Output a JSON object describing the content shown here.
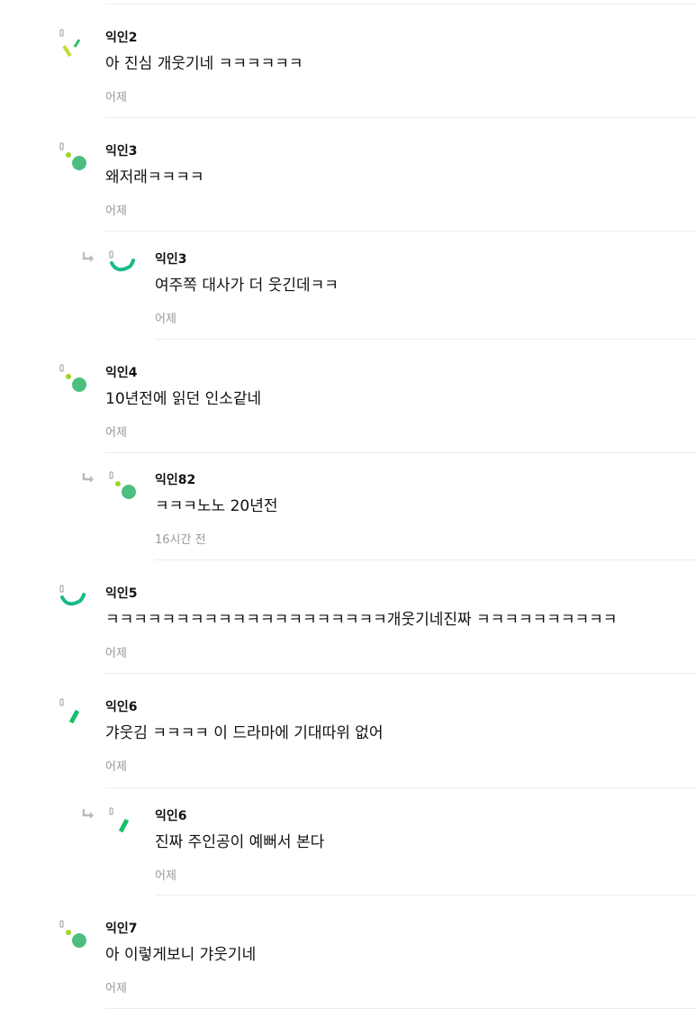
{
  "comments": [
    {
      "author": "익인2",
      "text": "아 진심 개웃기네 ㅋㅋㅋㅋㅋㅋ",
      "time": "어제",
      "avatar": "avatar-slash-icon",
      "is_reply": false
    },
    {
      "author": "익인3",
      "text": "왜저래ㅋㅋㅋㅋ",
      "time": "어제",
      "avatar": "avatar-dots-icon",
      "is_reply": false
    },
    {
      "author": "익인3",
      "text": "여주쪽 대사가 더 웃긴데ㅋㅋ",
      "time": "어제",
      "avatar": "avatar-arc-icon",
      "is_reply": true
    },
    {
      "author": "익인4",
      "text": "10년전에 읽던 인소같네",
      "time": "어제",
      "avatar": "avatar-dots-icon",
      "is_reply": false
    },
    {
      "author": "익인82",
      "text": "ㅋㅋㅋ노노 20년전",
      "time": "16시간 전",
      "avatar": "avatar-dots-icon",
      "is_reply": true
    },
    {
      "author": "익인5",
      "text": "ㅋㅋㅋㅋㅋㅋㅋㅋㅋㅋㅋㅋㅋㅋㅋㅋㅋㅋㅋㅋ개웃기네진짜 ㅋㅋㅋㅋㅋㅋㅋㅋㅋㅋ",
      "time": "어제",
      "avatar": "avatar-arc-icon",
      "is_reply": false
    },
    {
      "author": "익인6",
      "text": "갸웃김 ㅋㅋㅋㅋ 이 드라마에 기대따위 없어",
      "time": "어제",
      "avatar": "avatar-dash-icon",
      "is_reply": false
    },
    {
      "author": "익인6",
      "text": "진짜 주인공이 예뻐서 본다",
      "time": "어제",
      "avatar": "avatar-dash-icon",
      "is_reply": true
    },
    {
      "author": "익인7",
      "text": "아 이렇게보니 갸웃기네",
      "time": "어제",
      "avatar": "avatar-dots-icon",
      "is_reply": false
    }
  ],
  "colors": {
    "avatar_dot_large": "#4cbf7f",
    "avatar_dot_small": "#9fd52b",
    "avatar_arc": "#19b98a",
    "avatar_dash": "#14c06a",
    "avatar_slash": "#c2d93a",
    "avatar_tick": "#aaaaaa",
    "reply_arrow": "#bbbbbb",
    "time_text": "#999999",
    "divider": "#ebebeb"
  }
}
